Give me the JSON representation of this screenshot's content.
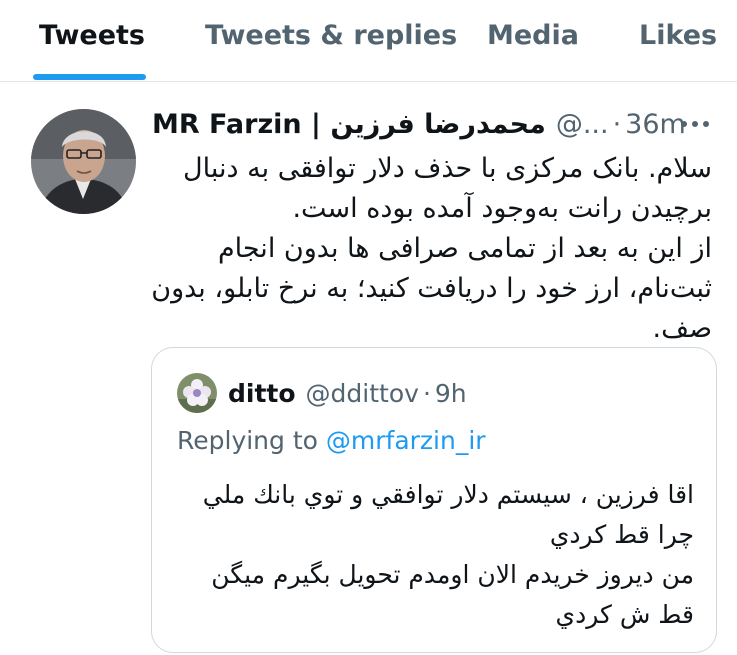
{
  "tabs": [
    {
      "label": "Tweets",
      "active": true
    },
    {
      "label": "Tweets & replies",
      "active": false
    },
    {
      "label": "Media",
      "active": false
    },
    {
      "label": "Likes",
      "active": false
    }
  ],
  "tweet": {
    "display_name": "MR Farzin | محمدرضا فرزین",
    "handle": "@...",
    "dot": "·",
    "time": "36m",
    "more_icon": "more-horizontal-icon",
    "text": "سلام. بانک مرکزی با حذف دلار توافقی به دنبال برچیدن رانت به‌وجود آمده بوده است.\nاز این به بعد از تمامی صرافی ها بدون انجام ثبت‌نام، ارز خود را دریافت کنید؛ به نرخ تابلو، بدون صف."
  },
  "quote": {
    "display_name": "ditto",
    "handle": "@ddittov",
    "dot": "·",
    "time": "9h",
    "replying_prefix": "Replying to",
    "replying_to": "@mrfarzin_ir",
    "text": "اقا فرزين ، سيستم دلار توافقي و توي بانك ملي چرا قط كردي\nمن ديروز خريدم الان اومدم تحويل بگيرم ميگن قط ش كردي"
  },
  "colors": {
    "accent": "#1d9bf0",
    "secondary_text": "#536471",
    "border": "#cfd9de"
  }
}
